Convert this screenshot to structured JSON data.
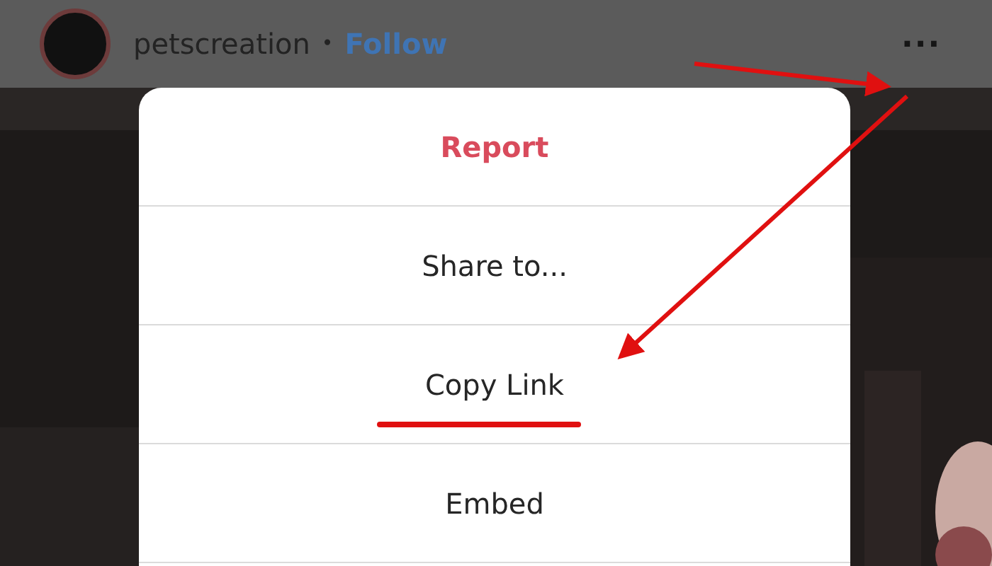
{
  "post_header": {
    "username": "petscreation",
    "separator": "•",
    "follow": "Follow",
    "more": "..."
  },
  "menu": {
    "items": [
      {
        "label": "Report",
        "kind": "danger",
        "underlined": false
      },
      {
        "label": "Share to...",
        "kind": "normal",
        "underlined": false
      },
      {
        "label": "Copy Link",
        "kind": "normal",
        "underlined": true
      },
      {
        "label": "Embed",
        "kind": "normal",
        "underlined": false
      }
    ]
  }
}
